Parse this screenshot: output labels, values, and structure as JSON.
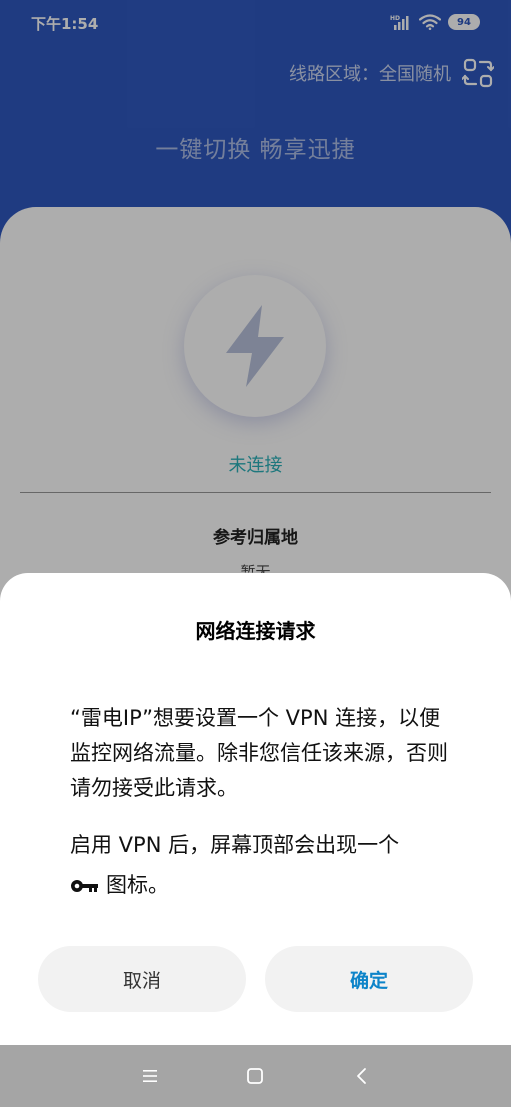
{
  "status_bar": {
    "time": "下午1:54",
    "battery": "94",
    "signal_icon": "signal-icon",
    "wifi_icon": "wifi-icon"
  },
  "header": {
    "region_label": "线路区域：全国随机",
    "region_icon": "switch-region-icon",
    "slogan": "一键切换 畅享迅捷"
  },
  "main": {
    "power_icon": "lightning-bolt-icon",
    "connection_status": "未连接",
    "reference_title": "参考归属地",
    "reference_value": "暂无"
  },
  "dialog": {
    "title": "网络连接请求",
    "message": "“雷电IP”想要设置一个 VPN 连接，以便监控网络流量。除非您信任该来源，否则请勿接受此请求。",
    "note_line1": "启用 VPN 后，屏幕顶部会出现一个",
    "note_line2": "图标。",
    "key_icon": "key-icon",
    "cancel_label": "取消",
    "confirm_label": "确定"
  },
  "nav_bar": {
    "menu_icon": "menu-icon",
    "home_icon": "home-icon",
    "back_icon": "back-icon"
  },
  "colors": {
    "brand_blue": "#2f58bf",
    "status_teal": "#2bb0b8",
    "confirm_blue": "#0d84c9"
  }
}
